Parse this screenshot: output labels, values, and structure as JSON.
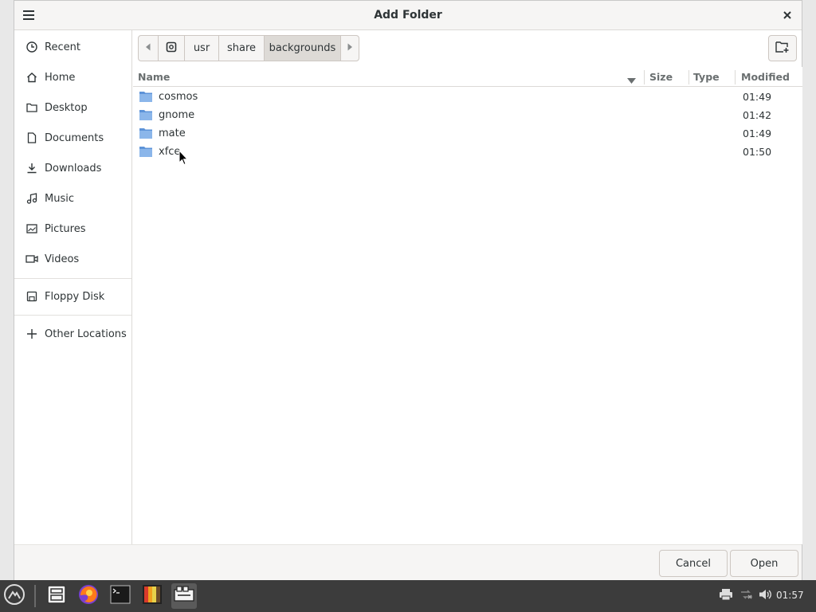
{
  "dialog": {
    "title": "Add Folder",
    "menu_icon": "hamburger-menu-icon",
    "close_icon": "close-icon"
  },
  "sidebar": {
    "items": [
      {
        "label": "Recent",
        "icon": "clock-icon"
      },
      {
        "label": "Home",
        "icon": "home-icon"
      },
      {
        "label": "Desktop",
        "icon": "folder-icon"
      },
      {
        "label": "Documents",
        "icon": "document-icon"
      },
      {
        "label": "Downloads",
        "icon": "download-icon"
      },
      {
        "label": "Music",
        "icon": "music-icon"
      },
      {
        "label": "Pictures",
        "icon": "picture-icon"
      },
      {
        "label": "Videos",
        "icon": "video-icon"
      },
      {
        "label": "Floppy Disk",
        "icon": "floppy-icon"
      },
      {
        "label": "Other Locations",
        "icon": "plus-icon"
      }
    ]
  },
  "pathbar": {
    "segments": [
      "usr",
      "share",
      "backgrounds"
    ],
    "active": "backgrounds"
  },
  "columns": {
    "name": "Name",
    "size": "Size",
    "type": "Type",
    "modified": "Modified"
  },
  "files": [
    {
      "name": "cosmos",
      "size": "",
      "type": "",
      "modified": "01:49"
    },
    {
      "name": "gnome",
      "size": "",
      "type": "",
      "modified": "01:42"
    },
    {
      "name": "mate",
      "size": "",
      "type": "",
      "modified": "01:49"
    },
    {
      "name": "xfce",
      "size": "",
      "type": "",
      "modified": "01:50"
    }
  ],
  "footer": {
    "cancel_label": "Cancel",
    "open_label": "Open"
  },
  "taskbar": {
    "clock": "01:57"
  },
  "colors": {
    "folder": "#6fa2e0",
    "taskbar": "#3c3c3c"
  }
}
